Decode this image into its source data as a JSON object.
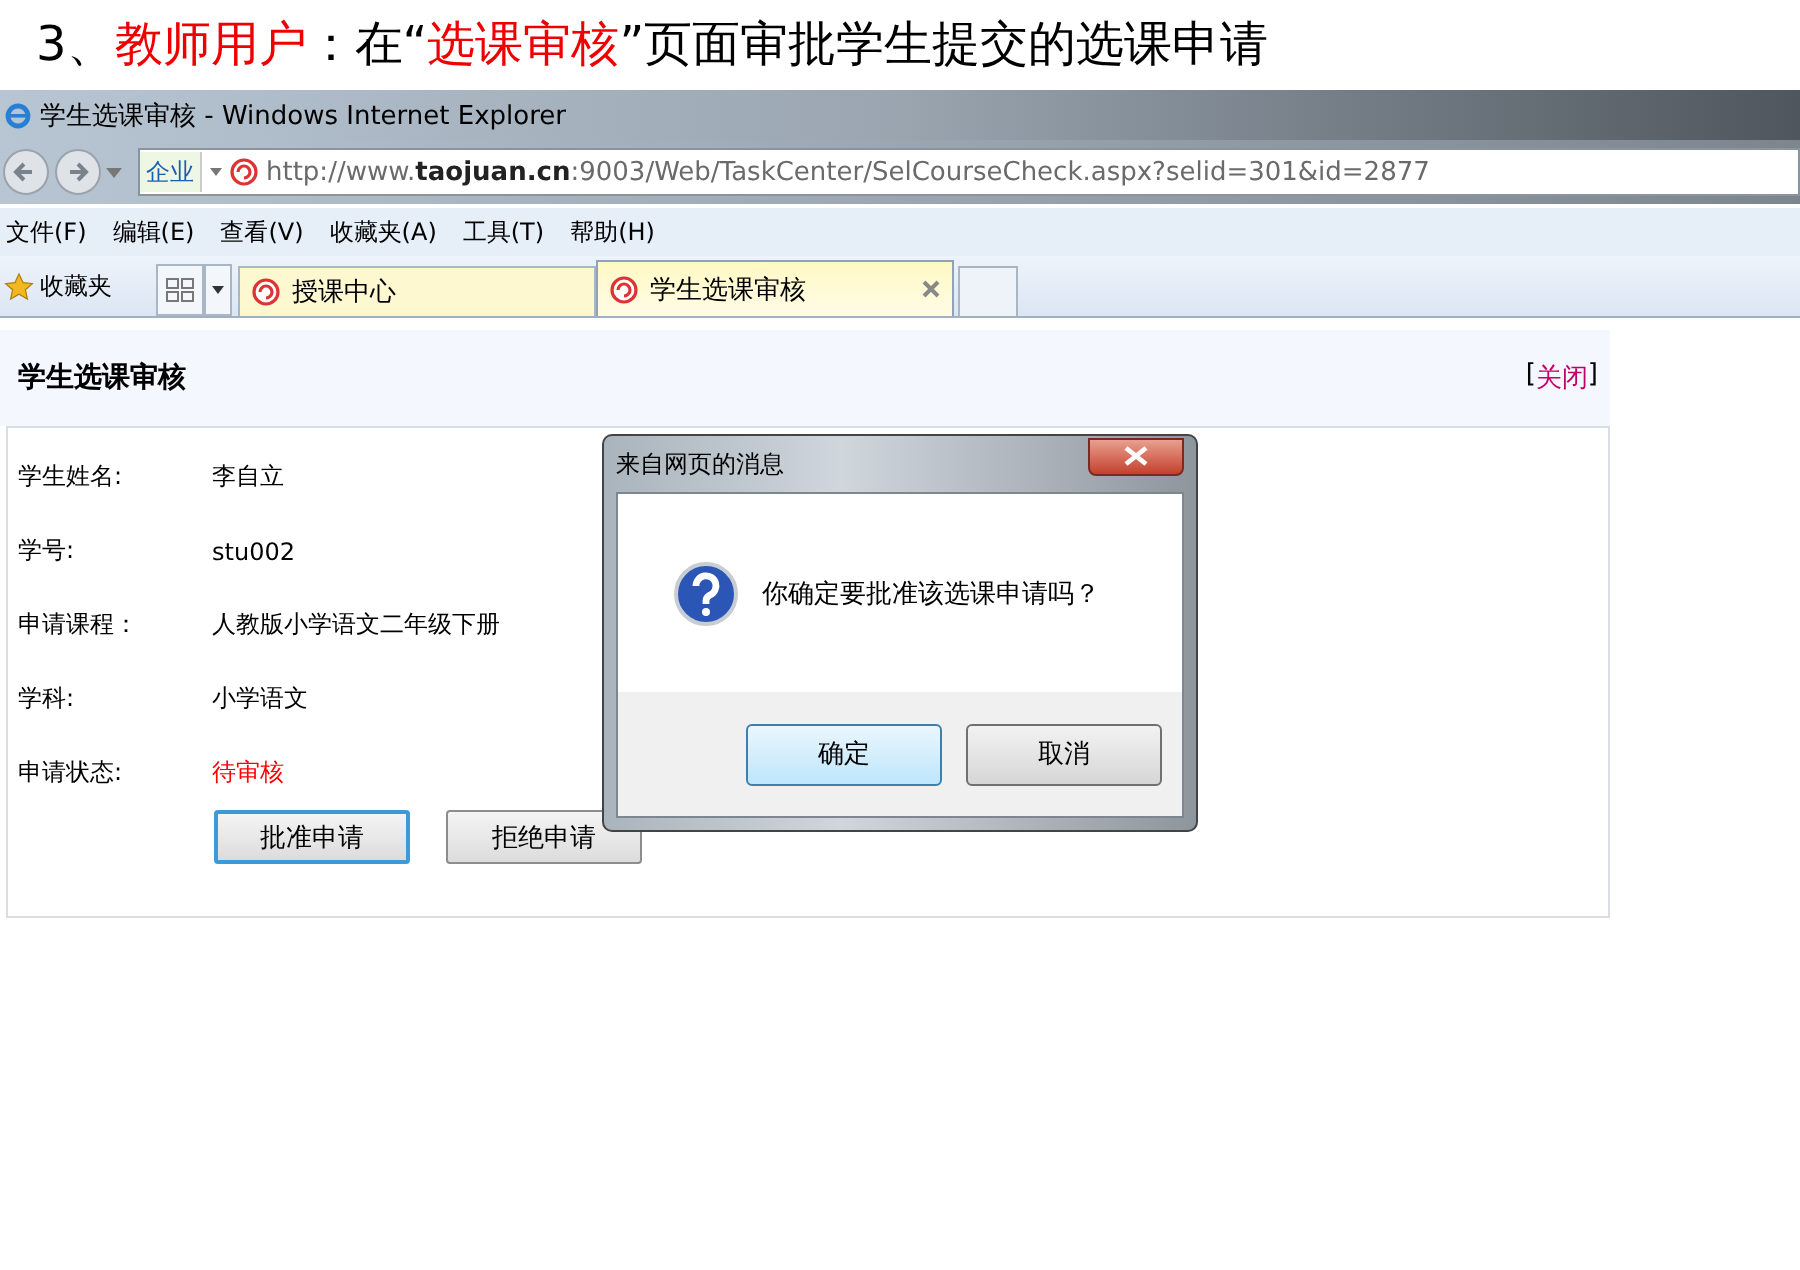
{
  "slide_heading": [
    {
      "text": "3、",
      "highlight": false
    },
    {
      "text": "教师用户",
      "highlight": true
    },
    {
      "text": "：在“",
      "highlight": false
    },
    {
      "text": "选课审核",
      "highlight": true
    },
    {
      "text": "”页面审批学生提交的选课申请",
      "highlight": false
    }
  ],
  "window": {
    "title": "学生选课审核 - Windows Internet Explorer"
  },
  "address_bar": {
    "group": "企业",
    "url": "http://www.**taojuan.cn**:9003/Web/TaskCenter/SelCourseCheck.aspx?selid=301&id=2877"
  },
  "menu": [
    "文件(F)",
    "编辑(E)",
    "查看(V)",
    "收藏夹(A)",
    "工具(T)",
    "帮助(H)"
  ],
  "favorites": {
    "label": "收藏夹"
  },
  "tabs": [
    {
      "label": "授课中心",
      "selected": false
    },
    {
      "label": "学生选课审核",
      "selected": true
    }
  ],
  "page": {
    "title": "学生选课审核",
    "close_link": {
      "open": "[",
      "label": "关闭",
      "close": "]"
    },
    "fields": [
      {
        "label": "学生姓名:",
        "value": "李自立",
        "kind": "text"
      },
      {
        "label": "学号:",
        "value": "stu002",
        "kind": "text"
      },
      {
        "label": "申请课程：",
        "value": "人教版小学语文二年级下册",
        "kind": "text"
      },
      {
        "label": "学科:",
        "value": "小学语文",
        "kind": "text"
      },
      {
        "label": "申请状态:",
        "value": "待审核",
        "kind": "status"
      }
    ],
    "buttons": [
      {
        "label": "批准申请",
        "focused": true
      },
      {
        "label": "拒绝申请",
        "focused": false
      }
    ]
  },
  "dialog": {
    "title": "来自网页的消息",
    "message": "你确定要批准该选课申请吗？",
    "buttons": [
      {
        "label": "确定",
        "focused": true
      },
      {
        "label": "取消",
        "focused": false
      }
    ]
  }
}
